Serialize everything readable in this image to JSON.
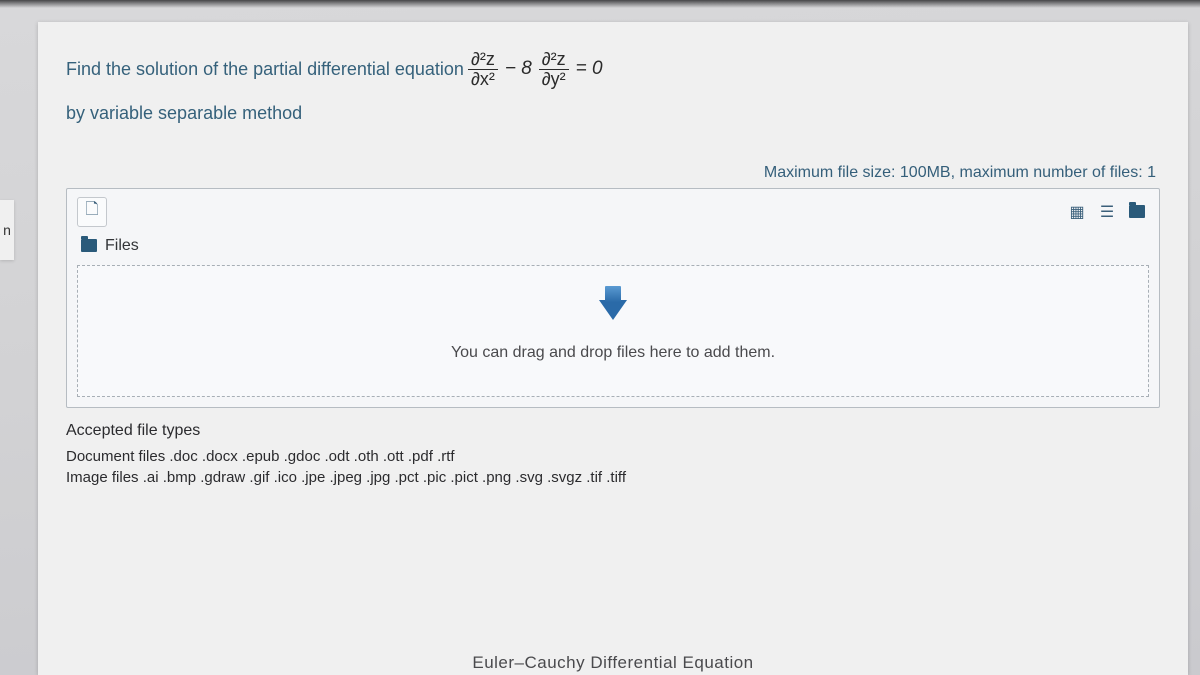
{
  "nav_sliver": "n",
  "question": {
    "prompt_before": "Find the solution of the partial differential equation",
    "eq": {
      "frac1_num": "∂²z",
      "frac1_den": "∂x²",
      "mid": "− 8",
      "frac2_num": "∂²z",
      "frac2_den": "∂y²",
      "tail": "= 0"
    },
    "prompt_line2": "by variable separable method"
  },
  "upload": {
    "limits": "Maximum file size: 100MB, maximum number of files: 1",
    "tab_label": "Files",
    "drop_text": "You can drag and drop files here to add them.",
    "accepted_heading": "Accepted file types",
    "doc_label": "Document files",
    "doc_exts": ".doc .docx .epub .gdoc .odt .oth .ott .pdf .rtf",
    "img_label": "Image files",
    "img_exts": ".ai .bmp .gdraw .gif .ico .jpe .jpeg .jpg .pct .pic .pict .png .svg .svgz .tif .tiff"
  },
  "cutoff_text": "Euler–Cauchy Differential Equation"
}
